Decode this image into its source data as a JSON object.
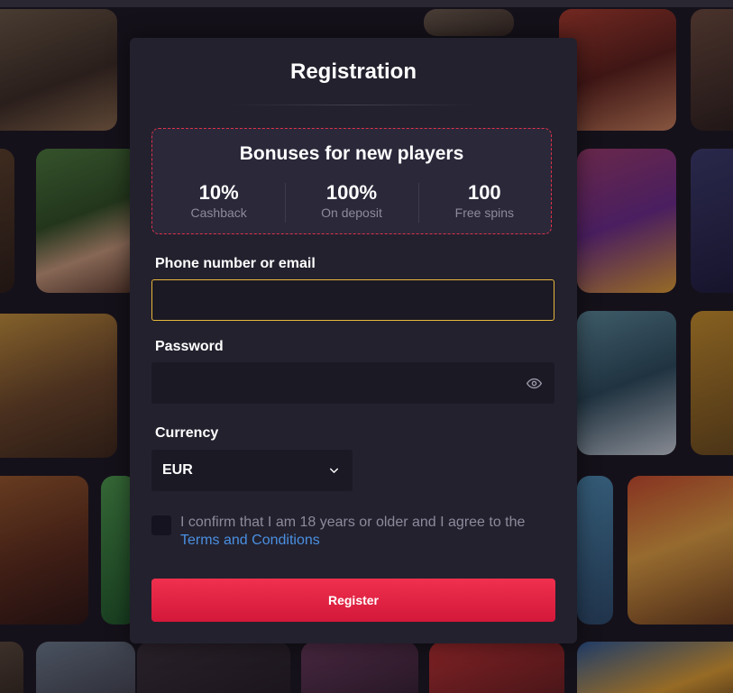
{
  "form": {
    "title": "Registration",
    "bonus": {
      "title": "Bonuses for new players",
      "stats": [
        {
          "value": "10%",
          "label": "Cashback"
        },
        {
          "value": "100%",
          "label": "On deposit"
        },
        {
          "value": "100",
          "label": "Free spins"
        }
      ]
    },
    "phone_label": "Phone number or email",
    "phone_value": "",
    "password_label": "Password",
    "password_value": "",
    "currency_label": "Currency",
    "currency_value": "EUR",
    "consent_text": "I confirm that I am 18 years or older and I agree to the",
    "terms_link": "Terms and Conditions",
    "register_label": "Register"
  },
  "colors": {
    "accent": "#e0314b",
    "focus": "#e7b73a",
    "link": "#4a90e2"
  },
  "icons": {
    "password_toggle": "eye-icon",
    "currency_dropdown": "chevron-down-icon"
  }
}
